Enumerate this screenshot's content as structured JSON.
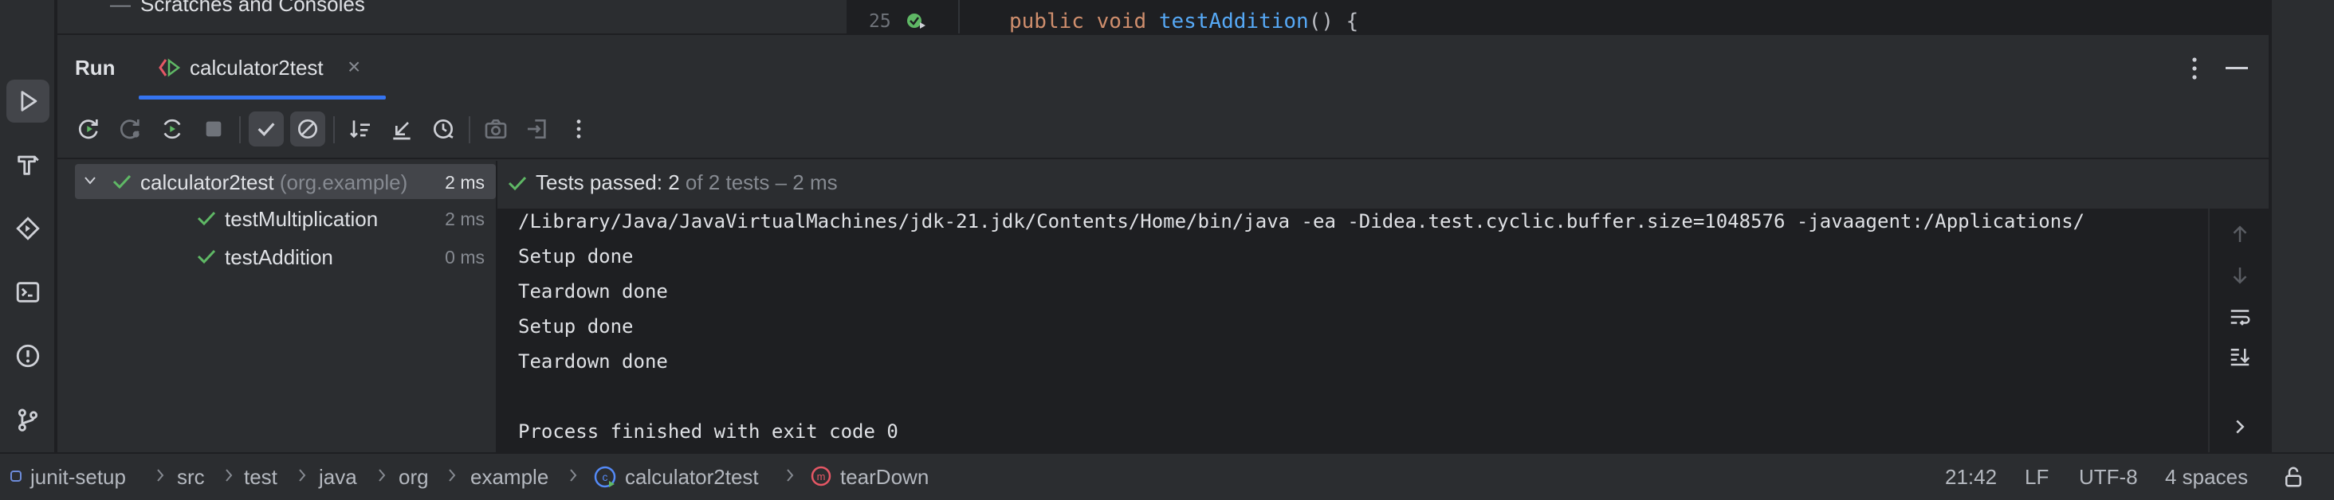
{
  "editor": {
    "project_item": "Scratches and Consoles",
    "line_number": "25",
    "code_keyword_1": "public",
    "code_keyword_2": "void",
    "code_method": "testAddition",
    "code_rest": "() {"
  },
  "run_panel": {
    "title": "Run",
    "tab_label": "calculator2test",
    "tab_close": "×"
  },
  "test_tree": {
    "root": {
      "name": "calculator2test",
      "package": "(org.example)",
      "duration": "2 ms"
    },
    "children": [
      {
        "name": "testMultiplication",
        "duration": "2 ms"
      },
      {
        "name": "testAddition",
        "duration": "0 ms"
      }
    ]
  },
  "console": {
    "status_passed": "Tests passed: 2",
    "status_detail": "of 2 tests – 2 ms",
    "lines": [
      "/Library/Java/JavaVirtualMachines/jdk-21.jdk/Contents/Home/bin/java -ea -Didea.test.cyclic.buffer.size=1048576 -javaagent:/Applications/",
      "Setup done",
      "Teardown done",
      "Setup done",
      "Teardown done",
      "",
      "Process finished with exit code 0"
    ]
  },
  "statusbar": {
    "breadcrumbs": [
      "junit-setup",
      "src",
      "test",
      "java",
      "org",
      "example",
      "calculator2test",
      "tearDown"
    ],
    "cursor_position": "21:42",
    "line_separator": "LF",
    "encoding": "UTF-8",
    "indent": "4 spaces"
  },
  "colors": {
    "accent": "#3574f0",
    "success": "#5fb865",
    "keyword": "#cf8e6d",
    "method": "#56a8f5"
  }
}
